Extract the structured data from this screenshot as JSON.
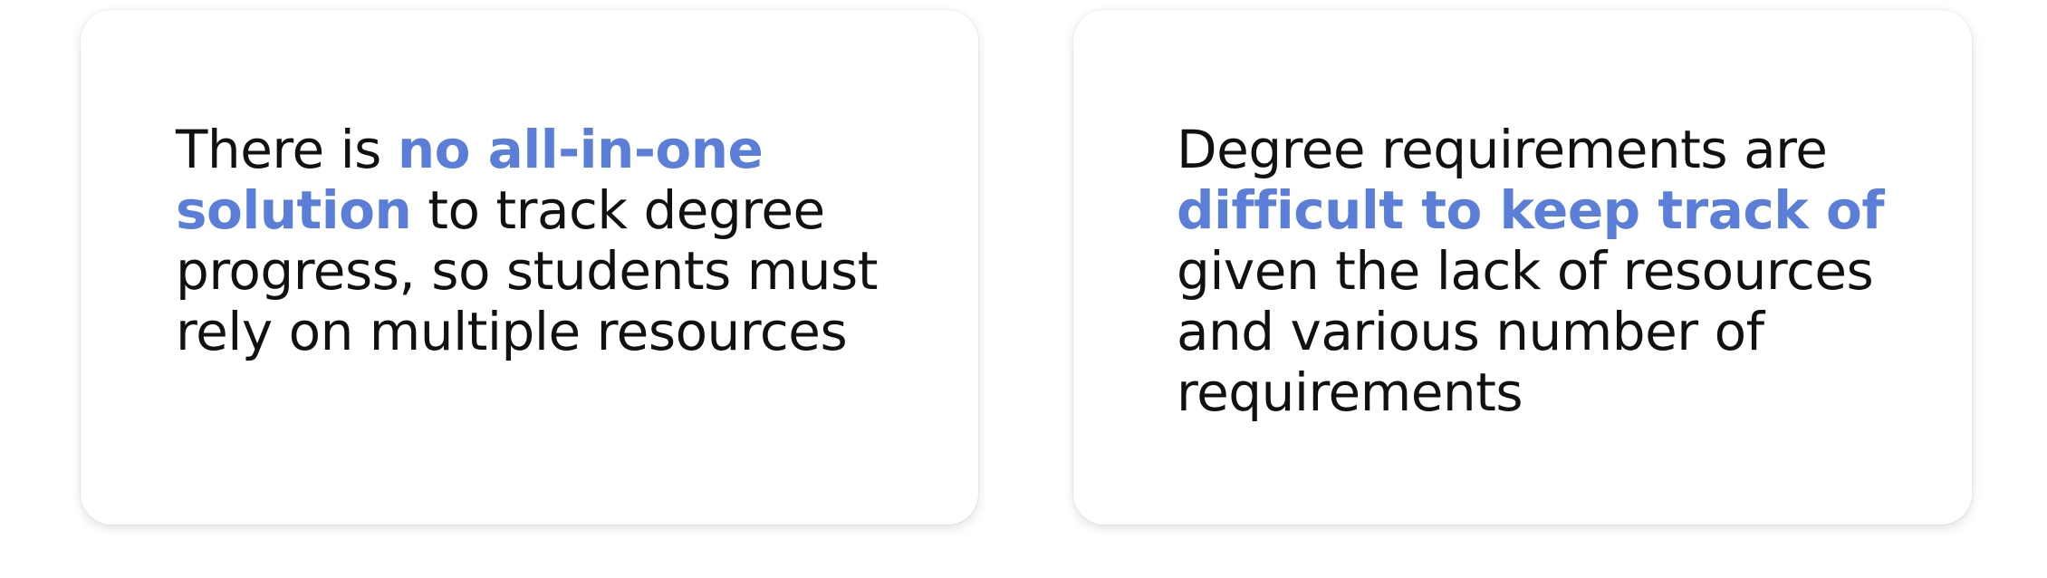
{
  "colors": {
    "highlight": "#5b7fd8",
    "text": "#111111"
  },
  "cards": [
    {
      "lines": [
        {
          "parts": [
            {
              "text": "There is "
            },
            {
              "text": "no all-in-one",
              "hl": true
            }
          ]
        },
        {
          "parts": [
            {
              "text": "solution",
              "hl": true
            },
            {
              "text": " to track degree"
            }
          ]
        },
        {
          "parts": [
            {
              "text": "progress, so students must"
            }
          ]
        },
        {
          "parts": [
            {
              "text": "rely on multiple resources"
            }
          ]
        }
      ]
    },
    {
      "lines": [
        {
          "parts": [
            {
              "text": "Degree requirements are"
            }
          ]
        },
        {
          "parts": [
            {
              "text": "difficult to keep track of",
              "hl": true
            }
          ]
        },
        {
          "parts": [
            {
              "text": "given the lack of resources"
            }
          ]
        },
        {
          "parts": [
            {
              "text": "and various number of"
            }
          ]
        },
        {
          "parts": [
            {
              "text": "requirements"
            }
          ]
        }
      ]
    }
  ]
}
